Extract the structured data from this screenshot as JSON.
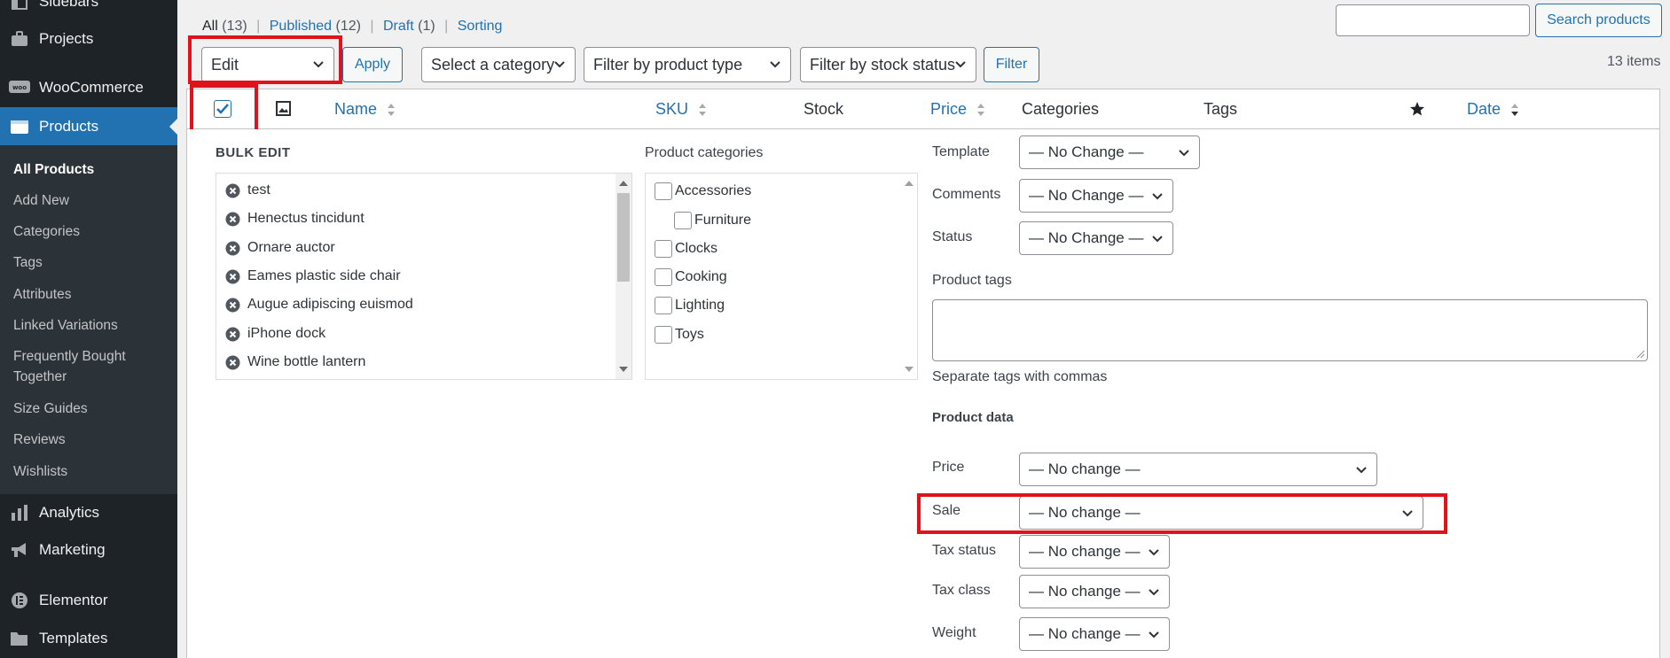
{
  "sidebar": {
    "top_items": [
      {
        "label": "Sidebars",
        "icon": "sidebar-icon"
      },
      {
        "label": "Projects",
        "icon": "briefcase-icon"
      },
      {
        "label": "WooCommerce",
        "icon": "woo-icon"
      },
      {
        "label": "Products",
        "icon": "products-icon"
      }
    ],
    "submenu": [
      "All Products",
      "Add New",
      "Categories",
      "Tags",
      "Attributes",
      "Linked Variations",
      "Frequently Bought Together",
      "Size Guides",
      "Reviews",
      "Wishlists"
    ],
    "bottom_items": [
      {
        "label": "Analytics",
        "icon": "bar-chart-icon"
      },
      {
        "label": "Marketing",
        "icon": "megaphone-icon"
      },
      {
        "label": "Elementor",
        "icon": "elementor-icon"
      },
      {
        "label": "Templates",
        "icon": "folder-icon"
      }
    ]
  },
  "views": {
    "all": "All",
    "all_count": "(13)",
    "published": "Published",
    "published_count": "(12)",
    "draft": "Draft",
    "draft_count": "(1)",
    "sorting": "Sorting",
    "separator": "|"
  },
  "search": {
    "value": "",
    "button": "Search products"
  },
  "toolbar": {
    "bulk_action": "Edit",
    "apply": "Apply",
    "category": "Select a category",
    "product_type": "Filter by product type",
    "stock_status": "Filter by stock status",
    "filter": "Filter",
    "items_count": "13 items"
  },
  "table_header": {
    "name": "Name",
    "sku": "SKU",
    "stock": "Stock",
    "price": "Price",
    "categories": "Categories",
    "tags": "Tags",
    "date": "Date"
  },
  "bulk_edit": {
    "title": "BULK EDIT",
    "products": [
      "test",
      "Henectus tincidunt",
      "Ornare auctor",
      "Eames plastic side chair",
      "Augue adipiscing euismod",
      "iPhone dock",
      "Wine bottle lantern"
    ],
    "categories_label": "Product categories",
    "categories": [
      "Accessories",
      "Furniture",
      "Clocks",
      "Cooking",
      "Lighting",
      "Toys"
    ],
    "template_label": "Template",
    "template_value": "— No Change —",
    "comments_label": "Comments",
    "comments_value": "— No Change —",
    "status_label": "Status",
    "status_value": "— No Change —",
    "tags_label": "Product tags",
    "tags_hint": "Separate tags with commas",
    "product_data_label": "Product data",
    "price_label": "Price",
    "price_value": "— No change —",
    "sale_label": "Sale",
    "sale_value": "— No change —",
    "tax_status_label": "Tax status",
    "tax_status_value": "— No change —",
    "tax_class_label": "Tax class",
    "tax_class_value": "— No change —",
    "weight_label": "Weight",
    "weight_value": "— No change —"
  },
  "colors": {
    "accent": "#2271b1",
    "sidebar": "#1d2327",
    "highlight": "#e0131a"
  }
}
